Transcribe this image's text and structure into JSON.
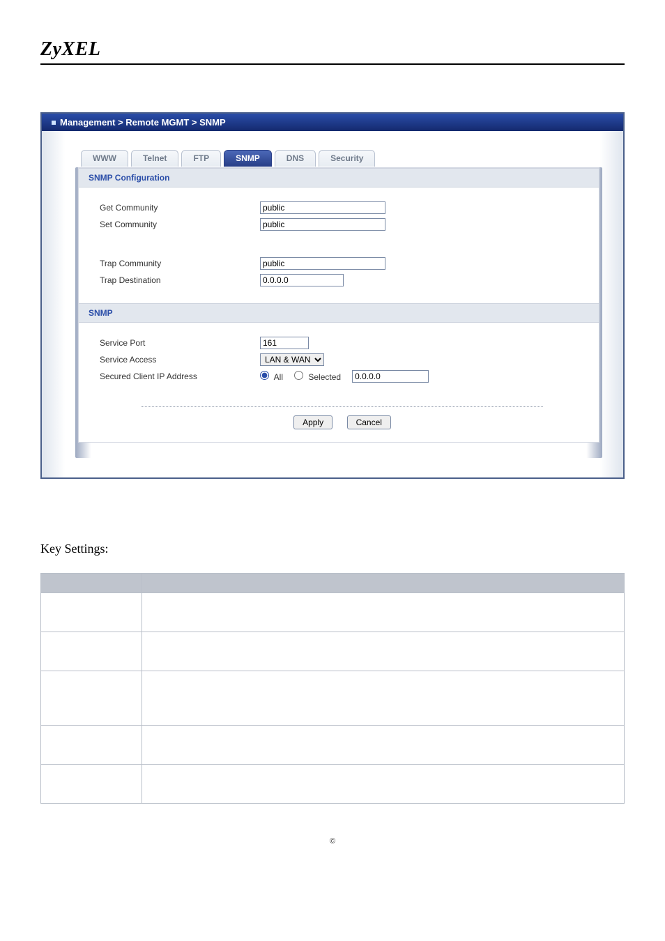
{
  "brand": "ZyXEL",
  "breadcrumb": "Management > Remote MGMT > SNMP",
  "tabs": [
    {
      "label": "WWW",
      "active": false
    },
    {
      "label": "Telnet",
      "active": false
    },
    {
      "label": "FTP",
      "active": false
    },
    {
      "label": "SNMP",
      "active": true
    },
    {
      "label": "DNS",
      "active": false
    },
    {
      "label": "Security",
      "active": false
    }
  ],
  "sections": {
    "snmp_config_title": "SNMP Configuration",
    "snmp_title": "SNMP"
  },
  "form": {
    "get_community": {
      "label": "Get Community",
      "value": "public"
    },
    "set_community": {
      "label": "Set Community",
      "value": "public"
    },
    "trap_community": {
      "label": "Trap  Community",
      "value": "public"
    },
    "trap_destination": {
      "label": "Trap  Destination",
      "value": "0.0.0.0"
    },
    "service_port": {
      "label": "Service Port",
      "value": "161"
    },
    "service_access": {
      "label": "Service Access",
      "selected": "LAN & WAN"
    },
    "secured_client": {
      "label": "Secured Client IP Address",
      "options": {
        "all": "All",
        "selected": "Selected"
      },
      "choice": "all",
      "ip": "0.0.0.0"
    }
  },
  "buttons": {
    "apply": "Apply",
    "cancel": "Cancel"
  },
  "key_settings": {
    "title": "Key Settings:",
    "headers": {
      "option": "",
      "description": ""
    }
  },
  "footer": "©"
}
